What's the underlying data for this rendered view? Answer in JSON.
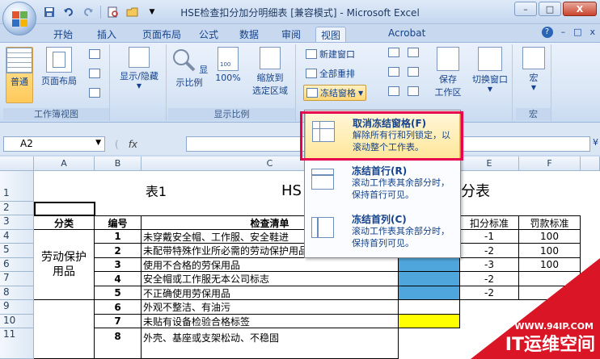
{
  "window": {
    "title": "HSE检查扣分加分明细表 [兼容模式] - Microsoft Excel",
    "controls": {
      "minimize": "–",
      "maximize": "□",
      "close": "X"
    }
  },
  "qat": {
    "save": "save-icon",
    "undo": "undo-icon",
    "redo": "redo-icon"
  },
  "tabs": [
    "开始",
    "插入",
    "页面布局",
    "公式",
    "数据",
    "审阅",
    "视图",
    "Acrobat"
  ],
  "active_tab": "视图",
  "ribbon_right": {
    "help": "?",
    "min": "–",
    "restore": "□",
    "close": "x"
  },
  "ribbon": {
    "workbook_views": {
      "label": "工作簿视图",
      "normal": "普通",
      "page_layout": "页面布局"
    },
    "show_hide": {
      "label": "显示/隐藏"
    },
    "zoom": {
      "label": "显示比例",
      "zoom": "显示比例",
      "zoom100": "100%",
      "zoom_sel_line1": "缩放到",
      "zoom_sel_line2": "选定区域"
    },
    "window": {
      "new_window": "新建窗口",
      "arrange_all": "全部重排",
      "freeze_panes": "冻结窗格",
      "save": "保存",
      "workspace": "工作区",
      "switch_windows": "切换窗口"
    },
    "macros": {
      "label": "宏",
      "macros": "宏"
    }
  },
  "formula_bar": {
    "name_box": "A2",
    "fx": "fx",
    "value": ""
  },
  "columns": [
    "A",
    "B",
    "C",
    "D",
    "E",
    "F"
  ],
  "rows": [
    "1",
    "2",
    "3",
    "4",
    "5",
    "6",
    "7",
    "8",
    "9",
    "10",
    "11"
  ],
  "sheet": {
    "row1_left": "表1",
    "row1_title_left": "HS",
    "row1_title_right": "分表",
    "headers": {
      "category": "分类",
      "number": "编号",
      "checklist": "检查清单",
      "deduct": "扣分标准",
      "fine": "罚款标准"
    },
    "category_group": "劳动保护用品",
    "items": [
      {
        "no": "1",
        "text": "未穿戴安全帽、工作服、安全鞋进",
        "deduct": "-1",
        "fine": "100"
      },
      {
        "no": "2",
        "text": "未配带特殊作业所必需的劳动保护用品进行作业",
        "deduct": "-2",
        "fine": "100"
      },
      {
        "no": "3",
        "text": "使用不合格的劳保用品",
        "deduct": "-3",
        "fine": "100"
      },
      {
        "no": "4",
        "text": "安全帽或工作服无本公司标志",
        "deduct": "-2",
        "fine": ""
      },
      {
        "no": "5",
        "text": "不正确使用劳保用品",
        "deduct": "-2",
        "fine": ""
      },
      {
        "no": "6",
        "text": "外观不整洁、有油污",
        "deduct": "",
        "fine": ""
      },
      {
        "no": "7",
        "text": "未贴有设备检验合格标签",
        "deduct": "",
        "fine": ""
      },
      {
        "no": "8",
        "text": "外壳、基座或支架松动、不稳固",
        "deduct": "",
        "fine": ""
      }
    ]
  },
  "freeze_menu": {
    "items": [
      {
        "title": "取消冻结窗格(F)",
        "desc": "解除所有行和列锁定，以滚动整个工作表。",
        "icon": "unfreeze-panes-icon"
      },
      {
        "title": "冻结首行(R)",
        "desc": "滚动工作表其余部分时，保持首行可见。",
        "icon": "freeze-top-row-icon"
      },
      {
        "title": "冻结首列(C)",
        "desc": "滚动工作表其余部分时，保持首列可见。",
        "icon": "freeze-first-column-icon"
      }
    ]
  },
  "watermark": {
    "url": "WWW.94IP.COM",
    "name": "IT运维空间"
  },
  "colors": {
    "highlight_border": "#e6004e",
    "fill_blue": "#4ea6dc",
    "fill_yellow": "#ffff00"
  }
}
